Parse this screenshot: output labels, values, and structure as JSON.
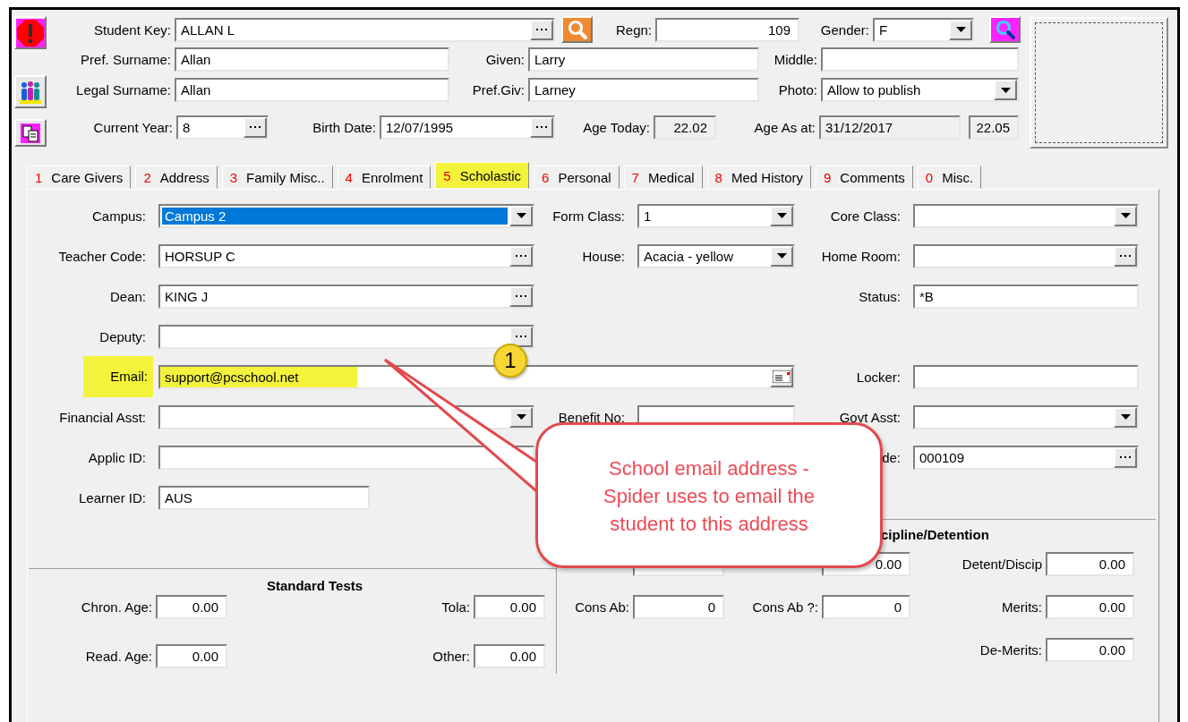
{
  "header": {
    "fields": [
      {
        "label": "Student Key:",
        "value": "ALLAN L",
        "kind": "lookup"
      },
      {
        "label": "Regn:",
        "value": "109",
        "kind": "number"
      },
      {
        "label": "Gender:",
        "value": "F",
        "kind": "select"
      },
      {
        "label": "Pref. Surname:",
        "value": "Allan",
        "kind": "text"
      },
      {
        "label": "Given:",
        "value": "Larry",
        "kind": "text"
      },
      {
        "label": "Middle:",
        "kind": "text"
      },
      {
        "label": "Legal Surname:",
        "value": "Allan",
        "kind": "text"
      },
      {
        "label": "Pref.Giv:",
        "value": "Larney",
        "kind": "text"
      },
      {
        "label": "Photo:",
        "value": "Allow to publish",
        "kind": "select"
      },
      {
        "label": "Current Year:",
        "value": "8",
        "kind": "lookup"
      },
      {
        "label": "Birth Date:",
        "value": "12/07/1995",
        "kind": "lookup"
      },
      {
        "label": "Age Today:",
        "value": "22.02",
        "kind": "readonly_number"
      },
      {
        "label": "Age As at:",
        "value": "31/12/2017",
        "kind": "readonly"
      },
      {
        "value": "22.05",
        "kind": "readonly_number"
      }
    ]
  },
  "tabs": [
    {
      "number": "1",
      "label": "Care Givers",
      "selected": false
    },
    {
      "number": "2",
      "label": "Address",
      "selected": false
    },
    {
      "number": "3",
      "label": "Family Misc..",
      "selected": false
    },
    {
      "number": "4",
      "label": "Enrolment",
      "selected": false
    },
    {
      "number": "5",
      "label": "Scholastic",
      "selected": true
    },
    {
      "number": "6",
      "label": "Personal",
      "selected": false
    },
    {
      "number": "7",
      "label": "Medical",
      "selected": false
    },
    {
      "number": "8",
      "label": "Med History",
      "selected": false
    },
    {
      "number": "9",
      "label": "Comments",
      "selected": false
    },
    {
      "number": "0",
      "label": "Misc.",
      "selected": false
    }
  ],
  "scholastic": {
    "fields": [
      {
        "label": "Campus:",
        "value": "Campus 2",
        "kind": "select",
        "focused": true
      },
      {
        "label": "Form Class:",
        "value": "1",
        "kind": "select"
      },
      {
        "label": "Core Class:",
        "kind": "select"
      },
      {
        "label": "Teacher Code:",
        "value": "HORSUP C",
        "kind": "lookup"
      },
      {
        "label": "House:",
        "value": "Acacia - yellow",
        "kind": "select"
      },
      {
        "label": "Home Room:",
        "kind": "lookup"
      },
      {
        "label": "Dean:",
        "value": "KING J",
        "kind": "lookup"
      },
      {
        "label": "Status:",
        "value": "*B",
        "kind": "text"
      },
      {
        "label": "Deputy:",
        "kind": "lookup"
      },
      {
        "label": "Email:",
        "value": "support@pcschool.net",
        "kind": "email",
        "highlighted": true
      },
      {
        "label": "Locker:",
        "kind": "text"
      },
      {
        "label": "Financial Asst:",
        "kind": "select"
      },
      {
        "label": "Benefit No:",
        "kind": "text"
      },
      {
        "label": "Govt Asst:",
        "kind": "select"
      },
      {
        "label": "Applic ID:",
        "kind": "text"
      },
      {
        "label": "de:",
        "value": "000109",
        "kind": "lookup"
      },
      {
        "label": "Learner ID:",
        "value": "AUS",
        "kind": "text"
      }
    ]
  },
  "standard_tests": {
    "title": "Standard Tests",
    "fields": [
      {
        "label": "Chron. Age:",
        "value": "0.00"
      },
      {
        "label": "Tola:",
        "value": "0.00"
      },
      {
        "label": "Read. Age:",
        "value": "0.00"
      },
      {
        "label": "Other:",
        "value": "0.00"
      }
    ]
  },
  "discipline": {
    "title": "cipline/Detention",
    "fields": [
      {
        "value": "0.00"
      },
      {
        "label": "Detent/Discip",
        "value": "0.00"
      },
      {
        "label": "Cons Ab:",
        "value": "0"
      },
      {
        "label": "Cons Ab ?:",
        "value": "0"
      },
      {
        "label": "Merits:",
        "value": "0.00"
      },
      {
        "label": "De-Merits:",
        "value": "0.00"
      }
    ]
  },
  "annotation": {
    "badge": "1",
    "callout": "School email address - Spider uses to email the student to this address"
  }
}
